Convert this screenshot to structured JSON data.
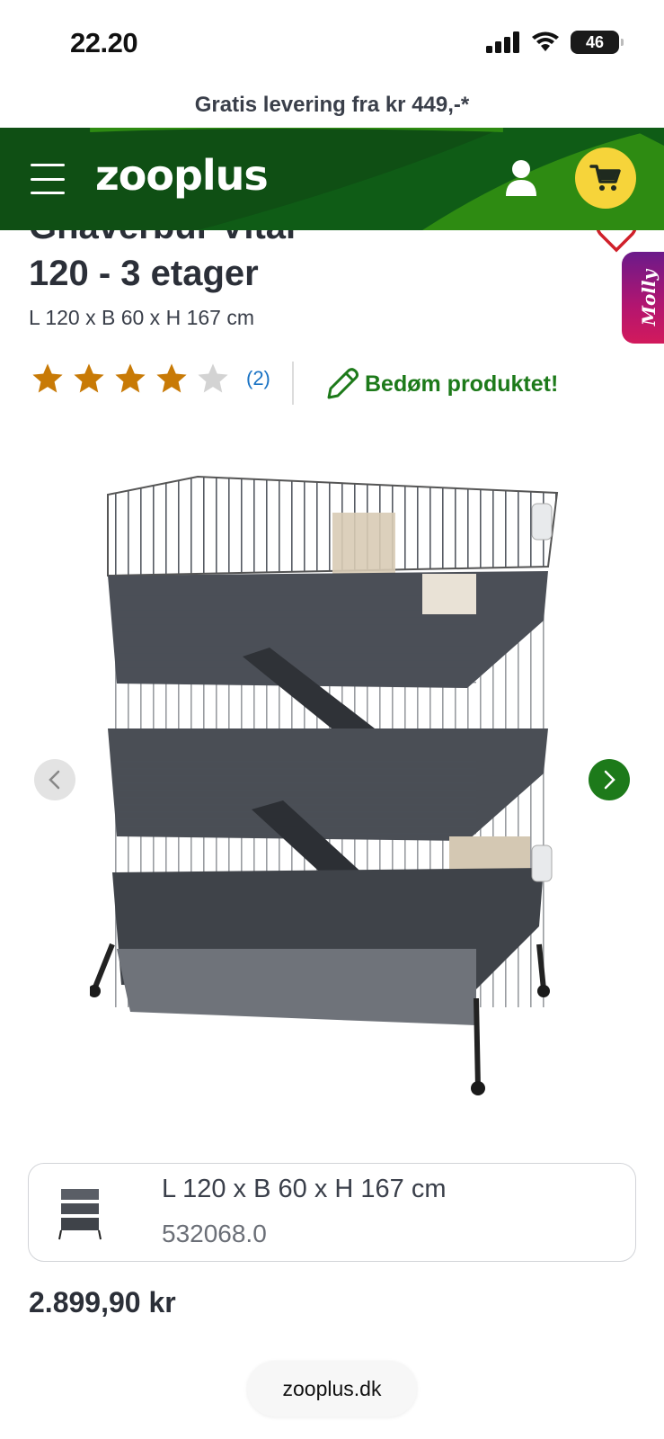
{
  "status_bar": {
    "time": "22.20",
    "battery_level": "46",
    "icons": [
      "signal-icon",
      "wifi-icon",
      "battery-icon"
    ]
  },
  "promo": {
    "text": "Gratis levering fra kr 449,-*"
  },
  "header": {
    "logo_text": "zooplus",
    "menu_icon": "hamburger-menu-icon",
    "user_icon": "user-icon",
    "cart_icon": "cart-icon",
    "colors": {
      "primary": "#0f5c16",
      "accent": "#2e8b12",
      "cart_bg": "#f6d43a"
    }
  },
  "product": {
    "title_line1": "Gnaverbur Vital",
    "title_line2": "120 - 3 etager",
    "dimensions": "L 120 x B 60 x H 167 cm",
    "wishlist_icon": "heart-icon",
    "side_tab_label": "Molly"
  },
  "rating": {
    "stars_filled": 4,
    "stars_total": 5,
    "review_count": "(2)",
    "rate_label": "Bedøm produktet!",
    "rate_icon": "pencil-icon",
    "star_color": "#c87a06",
    "empty_star_color": "#d3d3d3"
  },
  "gallery": {
    "prev_icon": "chevron-left-icon",
    "next_icon": "chevron-right-icon"
  },
  "variant": {
    "size": "L 120 x B 60 x H 167 cm",
    "code": "532068.0"
  },
  "price": "2.899,90 kr",
  "browser": {
    "url": "zooplus.dk"
  }
}
